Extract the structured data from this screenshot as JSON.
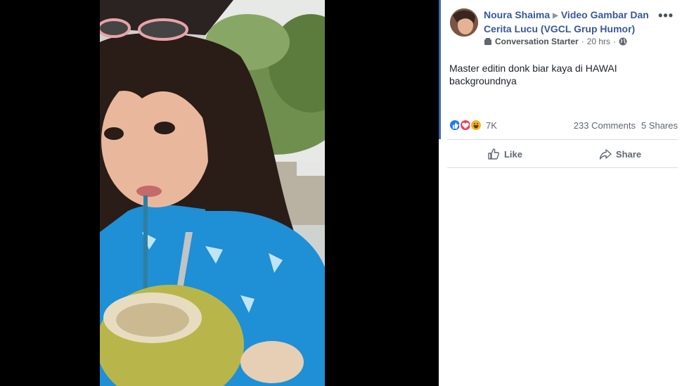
{
  "post": {
    "author": "Noura Shaima",
    "group": "Video Gambar Dan Cerita Lucu (VGCL Grup Humor)",
    "badge": "Conversation Starter",
    "time": "20 hrs",
    "privacy_icon": "globe-icon",
    "more_label": "•••",
    "text": "Master editin donk biar kaya di HAWAI backgroundnya"
  },
  "stats": {
    "reactions": [
      "like-icon",
      "love-icon",
      "haha-icon"
    ],
    "reaction_count": "7K",
    "comments": "233 Comments",
    "shares": "5 Shares"
  },
  "actions": {
    "like_label": "Like",
    "share_label": "Share"
  },
  "colors": {
    "link": "#385898",
    "accent": "#4267b2",
    "like": "#2078f4",
    "love": "#f33e58",
    "haha": "#f7b125"
  }
}
